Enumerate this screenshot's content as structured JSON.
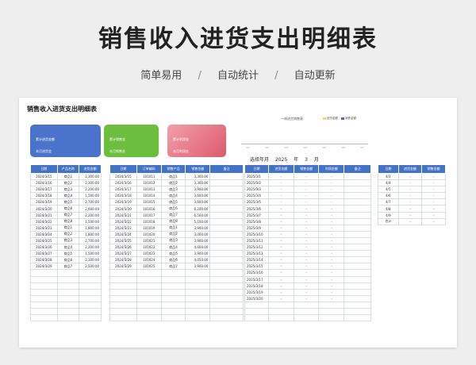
{
  "header": {
    "title": "销售收入进货支出明细表",
    "tags": [
      "简单易用",
      "自动统计",
      "自动更新"
    ],
    "separator": "/"
  },
  "sheet": {
    "title": "销售收入进货支出明细表",
    "cards": {
      "blue": {
        "line1": "累计进货金额",
        "line2": "本月进货金",
        "color": "#4a74cc"
      },
      "green": {
        "line1": "累计销售金",
        "line2": "本月销售金",
        "color": "#6cbf3d"
      },
      "pink": {
        "line1": "累计利润金",
        "line2": "本月利润金",
        "color": "#dd5a6c"
      }
    },
    "chart": {
      "title": "一周进货销售表",
      "legend": [
        "进货金额",
        "销售金额"
      ],
      "legend_colors": [
        "#f5d46b",
        "#4472c4"
      ],
      "ticks": [
        "1/1",
        "1/2",
        "1/3",
        "1/4",
        "1/5",
        "1/6",
        "1/7"
      ]
    },
    "picker": {
      "label": "选择年月",
      "year": "2025",
      "year_unit": "年",
      "month": "3",
      "month_unit": "月"
    },
    "purchase_table": {
      "headers": [
        "日期",
        "产品名称",
        "进货金额"
      ],
      "rows": [
        [
          "2024/3/15",
          "商品1",
          "2,300.00"
        ],
        [
          "2024/3/16",
          "商品2",
          "2,300.00"
        ],
        [
          "2024/3/17",
          "商品3",
          "2,200.00"
        ],
        [
          "2024/3/18",
          "商品4",
          "1,500.00"
        ],
        [
          "2024/3/19",
          "商品5",
          "2,700.00"
        ],
        [
          "2024/3/20",
          "商品6",
          "2,600.00"
        ],
        [
          "2024/3/21",
          "商品7",
          "2,200.00"
        ],
        [
          "2024/3/22",
          "商品8",
          "1,500.00"
        ],
        [
          "2024/3/23",
          "商品1",
          "1,800.00"
        ],
        [
          "2024/3/24",
          "商品2",
          "1,800.00"
        ],
        [
          "2024/3/25",
          "商品3",
          "2,700.00"
        ],
        [
          "2024/3/26",
          "商品4",
          "2,200.00"
        ],
        [
          "2024/3/27",
          "商品5",
          "1,500.00"
        ],
        [
          "2024/3/28",
          "商品6",
          "2,300.00"
        ],
        [
          "2024/3/29",
          "商品7",
          "2,500.00"
        ]
      ]
    },
    "sales_table": {
      "headers": [
        "日期",
        "订单编码",
        "销售产品",
        "销售金额",
        "备注"
      ],
      "rows": [
        [
          "2024/3/15",
          "101011",
          "商品1",
          "3,300.00",
          ""
        ],
        [
          "2024/3/16",
          "101012",
          "商品2",
          "3,300.00",
          ""
        ],
        [
          "2024/3/17",
          "101013",
          "商品3",
          "3,900.00",
          ""
        ],
        [
          "2024/3/18",
          "101014",
          "商品4",
          "3,600.00",
          ""
        ],
        [
          "2024/3/19",
          "101015",
          "商品5",
          "3,600.00",
          ""
        ],
        [
          "2024/3/20",
          "101016",
          "商品6",
          "6,200.00",
          ""
        ],
        [
          "2024/3/21",
          "101017",
          "商品7",
          "6,500.00",
          ""
        ],
        [
          "2024/3/22",
          "101018",
          "商品8",
          "5,100.00",
          ""
        ],
        [
          "2024/3/23",
          "101019",
          "商品1",
          "3,900.00",
          ""
        ],
        [
          "2024/3/24",
          "101020",
          "商品2",
          "3,000.00",
          ""
        ],
        [
          "2024/3/25",
          "101021",
          "商品3",
          "3,900.00",
          ""
        ],
        [
          "2024/3/26",
          "101022",
          "商品4",
          "4,600.00",
          ""
        ],
        [
          "2024/3/27",
          "101023",
          "商品5",
          "3,900.00",
          ""
        ],
        [
          "2024/3/28",
          "101024",
          "商品6",
          "4,050.00",
          ""
        ],
        [
          "2024/3/29",
          "101025",
          "商品7",
          "3,900.00",
          ""
        ]
      ]
    },
    "monthly_table": {
      "headers": [
        "日期",
        "进货金额",
        "销售金额",
        "利润金额",
        "备注"
      ],
      "rows": [
        [
          "2025/3/1",
          "-",
          "-",
          "-",
          ""
        ],
        [
          "2025/3/2",
          "-",
          "-",
          "-",
          ""
        ],
        [
          "2025/3/3",
          "-",
          "-",
          "-",
          ""
        ],
        [
          "2025/3/4",
          "-",
          "-",
          "-",
          ""
        ],
        [
          "2025/3/5",
          "-",
          "-",
          "-",
          ""
        ],
        [
          "2025/3/6",
          "-",
          "-",
          "-",
          ""
        ],
        [
          "2025/3/7",
          "-",
          "-",
          "-",
          ""
        ],
        [
          "2025/3/8",
          "-",
          "-",
          "-",
          ""
        ],
        [
          "2025/3/9",
          "-",
          "-",
          "-",
          ""
        ],
        [
          "2025/3/10",
          "-",
          "-",
          "-",
          ""
        ],
        [
          "2025/3/11",
          "-",
          "-",
          "-",
          ""
        ],
        [
          "2025/3/12",
          "-",
          "-",
          "-",
          ""
        ],
        [
          "2025/3/13",
          "-",
          "-",
          "-",
          ""
        ],
        [
          "2025/3/14",
          "-",
          "-",
          "-",
          ""
        ],
        [
          "2025/3/15",
          "-",
          "-",
          "-",
          ""
        ],
        [
          "2025/3/16",
          "-",
          "-",
          "-",
          ""
        ],
        [
          "2025/3/17",
          "-",
          "-",
          "-",
          ""
        ],
        [
          "2025/3/18",
          "-",
          "-",
          "-",
          ""
        ],
        [
          "2025/3/19",
          "-",
          "-",
          "-",
          ""
        ],
        [
          "2025/3/20",
          "-",
          "-",
          "-",
          ""
        ]
      ]
    },
    "weekly_table": {
      "headers": [
        "日期",
        "进货金额",
        "销售金额"
      ],
      "rows": [
        [
          "4/3",
          "-",
          "-"
        ],
        [
          "4/4",
          "-",
          "-"
        ],
        [
          "4/5",
          "-",
          "-"
        ],
        [
          "4/6",
          "-",
          "-"
        ],
        [
          "4/7",
          "-",
          "-"
        ],
        [
          "4/8",
          "-",
          "-"
        ],
        [
          "4/9",
          "-",
          "-"
        ],
        [
          "合计",
          "-",
          "-"
        ]
      ]
    }
  }
}
